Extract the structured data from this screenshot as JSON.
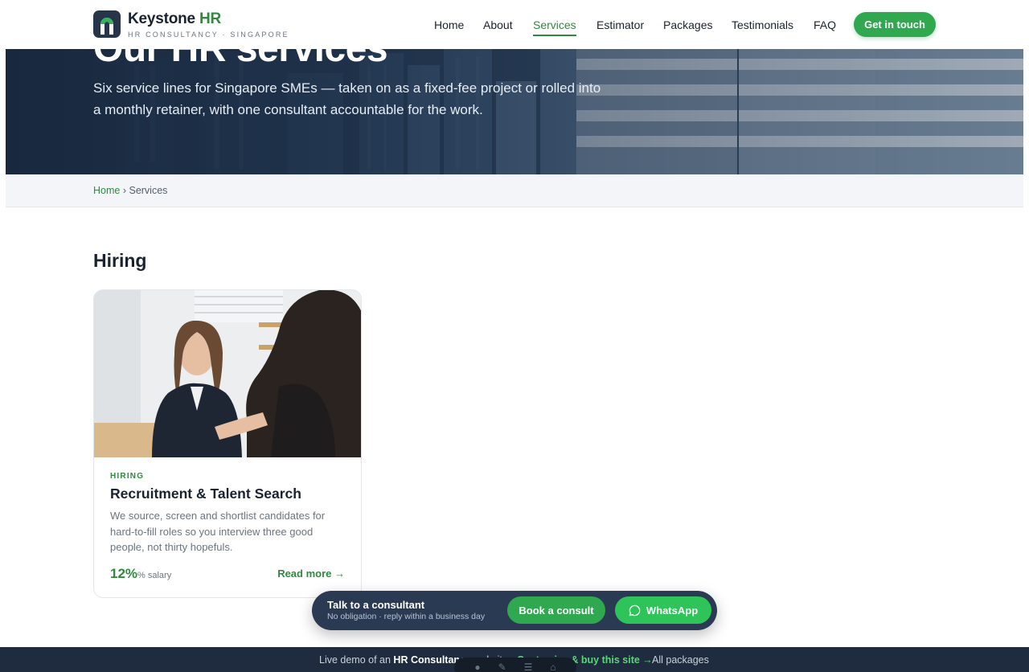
{
  "brand": {
    "name_main": "Keystone",
    "name_accent": "HR",
    "tagline": "HR CONSULTANCY · SINGAPORE",
    "accent_color": "#2e8b3e"
  },
  "nav": {
    "items": [
      "Home",
      "About",
      "Services",
      "Estimator",
      "Packages",
      "Testimonials",
      "FAQ"
    ],
    "active": "Services",
    "cta_label": "Get in touch"
  },
  "hero": {
    "title": "Our HR services",
    "subtitle": "Six service lines for Singapore SMEs — taken on as a fixed-fee project or rolled into a monthly retainer, with one consultant accountable for the work."
  },
  "breadcrumb": {
    "home": "Home",
    "separator": "›",
    "current": "Services"
  },
  "section": {
    "title": "Hiring"
  },
  "cards": [
    {
      "category": "HIRING",
      "title": "Recruitment & Talent Search",
      "description": "We source, screen and shortlist candidates for hard-to-fill roles so you interview three good people, not thirty hopefuls.",
      "price_value": "12%",
      "price_unit": "% salary",
      "link_label": "Read more →"
    }
  ],
  "consult_bar": {
    "title": "Talk to a consultant",
    "subtitle": "No obligation · reply within a business day",
    "book_label": "Book a consult",
    "whatsapp_label": "WhatsApp"
  },
  "demo_strip": {
    "prefix": "Live demo of an ",
    "bold": "HR Consultancy",
    "suffix": " website",
    "link_label": "Customise & buy this site →",
    "packages_label": "All packages"
  }
}
